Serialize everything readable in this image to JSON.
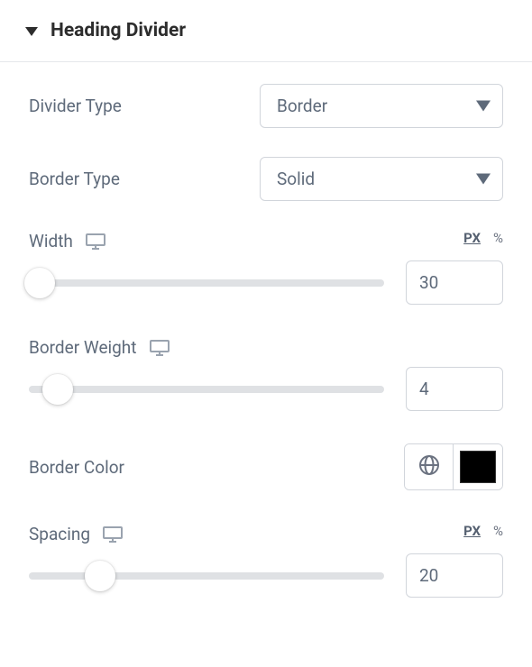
{
  "section": {
    "title": "Heading Divider",
    "expanded": true
  },
  "divider_type": {
    "label": "Divider Type",
    "value": "Border",
    "options": [
      "Border"
    ]
  },
  "border_type": {
    "label": "Border Type",
    "value": "Solid",
    "options": [
      "Solid"
    ]
  },
  "width": {
    "label": "Width",
    "value": "30",
    "units": {
      "active": "PX",
      "other": "%"
    },
    "slider_pct": 3
  },
  "border_weight": {
    "label": "Border Weight",
    "value": "4",
    "slider_pct": 8
  },
  "border_color": {
    "label": "Border Color",
    "value": "#000000"
  },
  "spacing": {
    "label": "Spacing",
    "value": "20",
    "units": {
      "active": "PX",
      "other": "%"
    },
    "slider_pct": 20
  }
}
